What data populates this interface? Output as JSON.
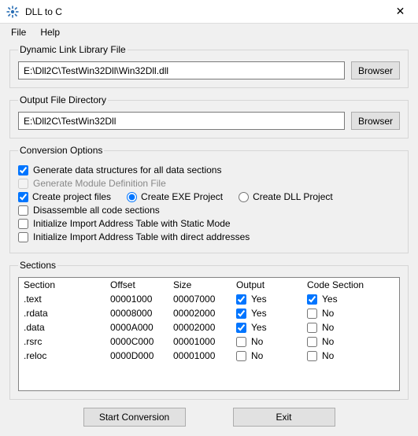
{
  "window": {
    "title": "DLL to C"
  },
  "menu": {
    "file": "File",
    "help": "Help"
  },
  "groups": {
    "dll": {
      "legend": "Dynamic Link Library File",
      "path": "E:\\Dll2C\\TestWin32Dll\\Win32Dll.dll",
      "browse": "Browser"
    },
    "out": {
      "legend": "Output File Directory",
      "path": "E:\\Dll2C\\TestWin32Dll",
      "browse": "Browser"
    },
    "opts": {
      "legend": "Conversion Options",
      "gen_structs": "Generate data structures for all data sections",
      "gen_def": "Generate Module Definition File",
      "create_proj": "Create project files",
      "create_exe": "Create EXE Project",
      "create_dll": "Create DLL Project",
      "disasm": "Disassemble all code sections",
      "iat_static": "Initialize Import Address Table with Static Mode",
      "iat_direct": "Initialize Import Address Table with direct addresses"
    },
    "sections": {
      "legend": "Sections",
      "headers": {
        "section": "Section",
        "offset": "Offset",
        "size": "Size",
        "output": "Output",
        "code": "Code Section"
      },
      "yes": "Yes",
      "no": "No",
      "rows": [
        {
          "name": ".text",
          "offset": "00001000",
          "size": "00007000",
          "output": true,
          "code": true
        },
        {
          "name": ".rdata",
          "offset": "00008000",
          "size": "00002000",
          "output": true,
          "code": false
        },
        {
          "name": ".data",
          "offset": "0000A000",
          "size": "00002000",
          "output": true,
          "code": false
        },
        {
          "name": ".rsrc",
          "offset": "0000C000",
          "size": "00001000",
          "output": false,
          "code": false
        },
        {
          "name": ".reloc",
          "offset": "0000D000",
          "size": "00001000",
          "output": false,
          "code": false
        }
      ]
    }
  },
  "footer": {
    "start": "Start Conversion",
    "exit": "Exit"
  }
}
